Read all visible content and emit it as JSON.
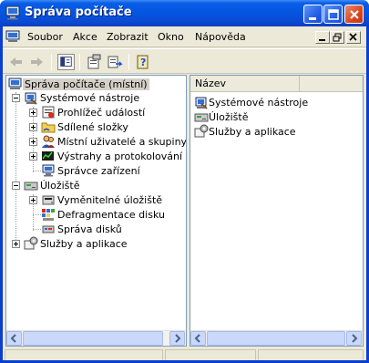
{
  "window": {
    "title": "Správa počítače"
  },
  "menubar": {
    "items": [
      "Soubor",
      "Akce",
      "Zobrazit",
      "Okno",
      "Nápověda"
    ]
  },
  "toolbar": {
    "buttons": [
      "back-arrow-icon",
      "forward-arrow-icon",
      "show-hide-tree-icon",
      "properties-icon",
      "export-list-icon",
      "help-icon"
    ]
  },
  "tree": {
    "root": "Správa počítače (místní)",
    "system_tools": "Systémové nástroje",
    "event_viewer": "Prohlížeč událostí",
    "shared_folders": "Sdílené složky",
    "local_users": "Místní uživatelé a skupiny",
    "alerts": "Výstrahy a protokolování výk",
    "device_manager": "Správce zařízení",
    "storage": "Úložiště",
    "removable_storage": "Vyměnitelné úložiště",
    "defrag": "Defragmentace disku",
    "disk_management": "Správa disků",
    "services": "Služby a aplikace"
  },
  "list": {
    "column_name": "Název",
    "items": [
      "Systémové nástroje",
      "Úložiště",
      "Služby a aplikace"
    ]
  },
  "colors": {
    "titlebar": "#0a5ee6",
    "selection": "#d4d0c8"
  }
}
